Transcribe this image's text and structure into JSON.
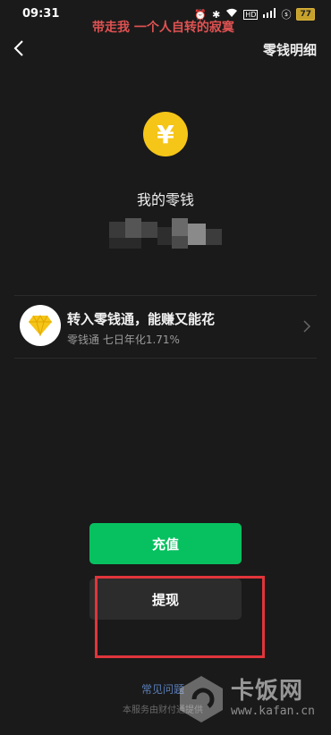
{
  "status_bar": {
    "time": "09:31",
    "battery": "77"
  },
  "overlay_caption": "带走我 一个人自转的寂寞",
  "nav": {
    "title": "零钱明细"
  },
  "balance": {
    "label": "我的零钱"
  },
  "promo": {
    "title": "转入零钱通，能赚又能花",
    "subtitle": "零钱通 七日年化1.71%"
  },
  "buttons": {
    "recharge": "充值",
    "withdraw": "提现"
  },
  "footer": {
    "faq": "常见问题",
    "note": "本服务由财付通提供"
  },
  "watermark": {
    "title": "卡饭网",
    "url": "www.kafan.cn"
  },
  "colors": {
    "background": "#1a1a1a",
    "accent_green": "#07c160",
    "coin_yellow": "#f5c518",
    "highlight_red": "#e0353b",
    "link_blue": "#5b7eb8"
  },
  "icons": {
    "back": "chevron-left-icon",
    "coin": "yen-coin-icon",
    "promo": "diamond-icon",
    "promo_arrow": "chevron-right-icon"
  }
}
